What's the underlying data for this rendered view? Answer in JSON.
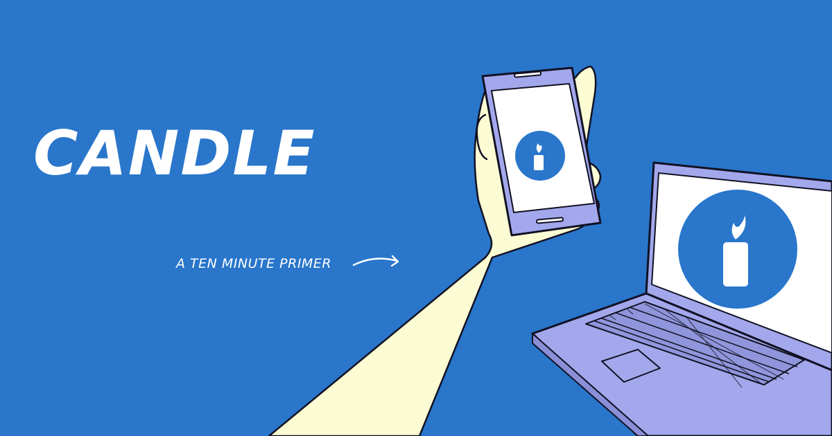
{
  "banner": {
    "title": "CANDLE",
    "subtitle": "A TEN MINUTE PRIMER"
  },
  "colors": {
    "background": "#2976CB",
    "arm": "#FBFBD4",
    "device_body": "#A3A8EC",
    "screen": "#FFFFFF",
    "logo_circle": "#2976CB",
    "outline": "#111122"
  },
  "icons": {
    "arrow": "curved-arrow-icon",
    "phone": "smartphone-icon",
    "laptop": "laptop-icon",
    "logo": "candle-icon"
  }
}
